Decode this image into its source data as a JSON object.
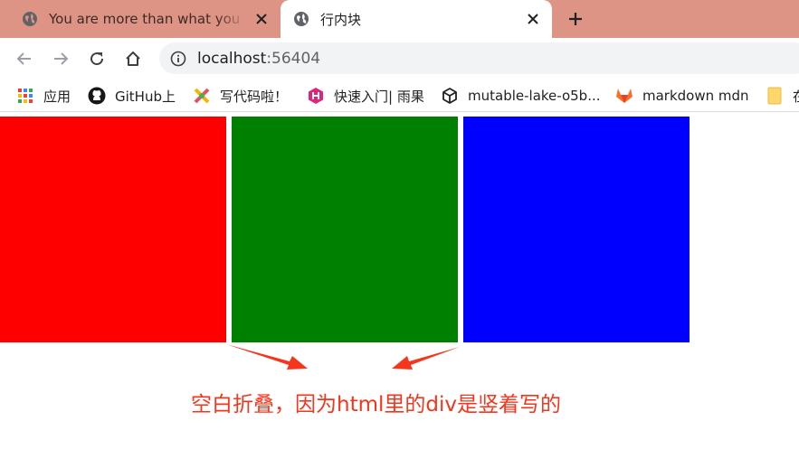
{
  "tabs": [
    {
      "title": "You are more than what you have become",
      "active": false
    },
    {
      "title": "行内块",
      "active": true
    }
  ],
  "address": {
    "host": "localhost",
    "port": ":56404"
  },
  "bookmarks": [
    {
      "label": "应用",
      "icon": "apps-grid-icon"
    },
    {
      "label": "GitHub上",
      "icon": "github-icon"
    },
    {
      "label": "写代码啦！",
      "icon": "xiedaimala-icon"
    },
    {
      "label": "快速入门| 雨果",
      "icon": "hugo-icon"
    },
    {
      "label": "mutable-lake-o5b...",
      "icon": "codesandbox-icon"
    },
    {
      "label": "markdown mdn",
      "icon": "gitlab-icon"
    },
    {
      "label": "在",
      "icon": "folder-icon"
    }
  ],
  "content": {
    "boxes": [
      {
        "name": "red-box",
        "color": "#ff0000"
      },
      {
        "name": "green-box",
        "color": "#008000"
      },
      {
        "name": "blue-box",
        "color": "#0000ff"
      }
    ],
    "annotation": "空白折叠，因为html里的div是竖着写的",
    "annotation_color": "#f5361c"
  }
}
